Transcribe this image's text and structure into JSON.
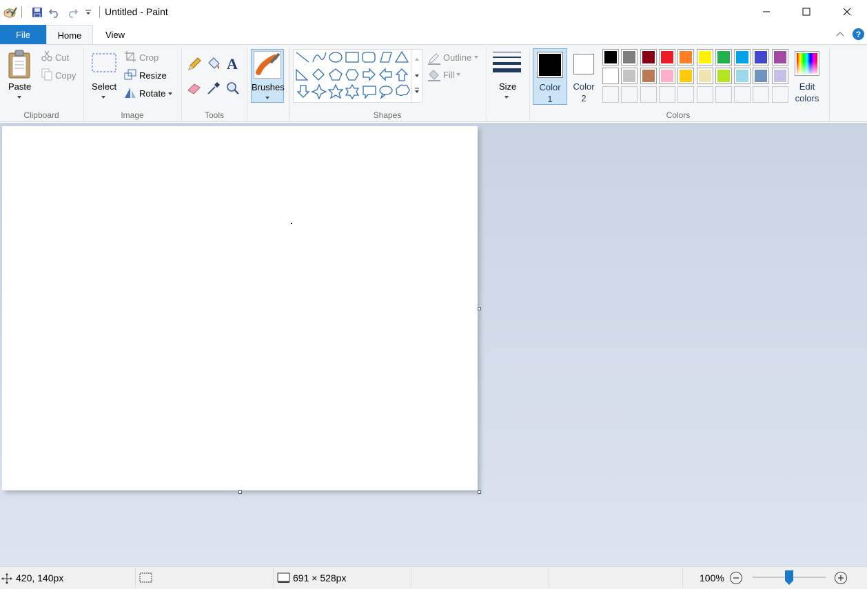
{
  "window": {
    "title": "Untitled - Paint"
  },
  "quick_access": {
    "icons": [
      "paint-app-icon",
      "save-icon",
      "undo-icon",
      "redo-icon",
      "customize-dropdown-icon"
    ]
  },
  "tabs": {
    "file": "File",
    "home": "Home",
    "view": "View"
  },
  "clipboard": {
    "paste": "Paste",
    "cut": "Cut",
    "copy": "Copy",
    "group": "Clipboard"
  },
  "image": {
    "select": "Select",
    "crop": "Crop",
    "resize": "Resize",
    "rotate": "Rotate",
    "group": "Image"
  },
  "tools": {
    "group": "Tools"
  },
  "brushes": {
    "label": "Brushes"
  },
  "shapes": {
    "outline": "Outline",
    "fill": "Fill",
    "group": "Shapes"
  },
  "size": {
    "label": "Size"
  },
  "colors": {
    "color1_line1": "Color",
    "color1_line2": "1",
    "color2_line1": "Color",
    "color2_line2": "2",
    "edit_line1": "Edit",
    "edit_line2": "colors",
    "group": "Colors",
    "color1_value": "#000000",
    "color2_value": "#ffffff",
    "palette": [
      "#000000",
      "#7f7f7f",
      "#880015",
      "#ed1c24",
      "#ff7f27",
      "#fff200",
      "#22b14c",
      "#00a2e8",
      "#3f48cc",
      "#a349a4",
      "#ffffff",
      "#c3c3c3",
      "#b97a57",
      "#ffaec9",
      "#ffc90e",
      "#efe4b0",
      "#b5e61d",
      "#99d9ea",
      "#7092be",
      "#c8bfe7",
      "",
      "",
      "",
      "",
      "",
      "",
      "",
      "",
      "",
      ""
    ]
  },
  "status": {
    "cursor_pos": "420, 140px",
    "canvas_size": "691 × 528px",
    "zoom": "100%",
    "zoom_slider_fraction": 0.5
  }
}
